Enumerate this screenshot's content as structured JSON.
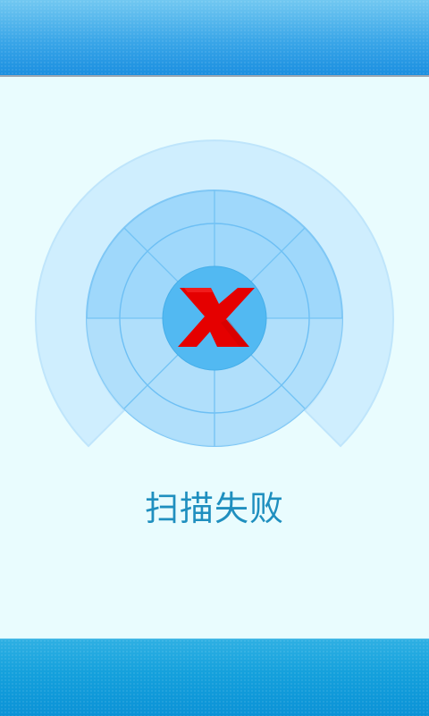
{
  "screen": {
    "status_text": "扫描失败",
    "state": "failed"
  },
  "icons": {
    "radar": "radar-icon",
    "failure": "x-mark-icon"
  },
  "colors": {
    "header_blue": "#3aa6e8",
    "footer_blue": "#0b92d6",
    "background": "#e9fcfe",
    "radar_light": "#cfeefe",
    "radar_medium": "#9fd8fb",
    "radar_center": "#52b9f2",
    "error_red": "#e50000",
    "text_blue": "#1f8fbf"
  }
}
